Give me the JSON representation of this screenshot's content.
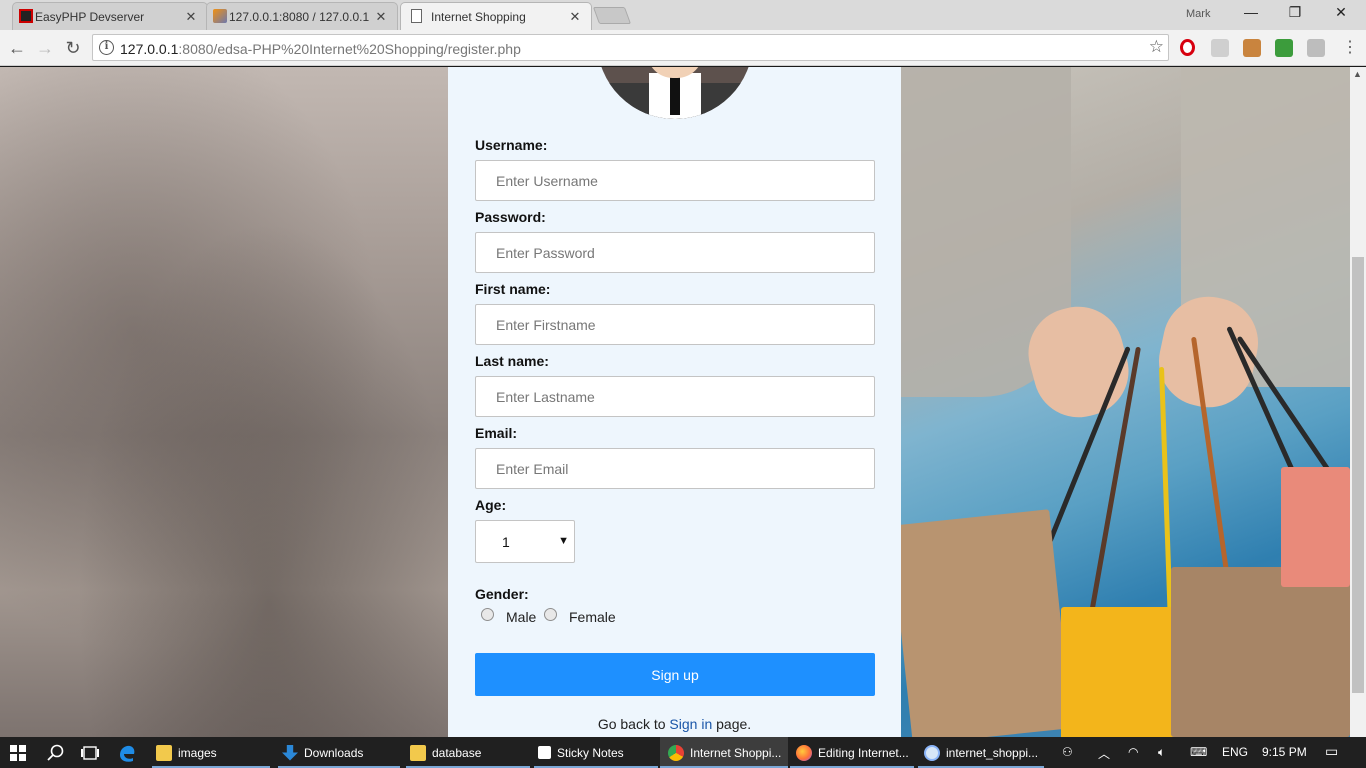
{
  "browser": {
    "tabs": [
      {
        "title": "EasyPHP Devserver",
        "close": "✕",
        "active": false
      },
      {
        "title": "127.0.0.1:8080 / 127.0.0.1",
        "close": "✕",
        "active": false
      },
      {
        "title": "Internet Shopping",
        "close": "✕",
        "active": true
      }
    ],
    "profile_name": "Mark",
    "window_controls": {
      "minimize": "—",
      "maximize": "❐",
      "close": "✕"
    },
    "nav": {
      "back": "←",
      "forward": "→",
      "reload": "↻"
    },
    "address": {
      "host": "127.0.0.1",
      "path": ":8080/edsa-PHP%20Internet%20Shopping/register.php",
      "info": "i",
      "star": "☆"
    }
  },
  "form": {
    "username": {
      "label": "Username:",
      "placeholder": "Enter Username"
    },
    "password": {
      "label": "Password:",
      "placeholder": "Enter Password"
    },
    "firstname": {
      "label": "First name:",
      "placeholder": "Enter Firstname"
    },
    "lastname": {
      "label": "Last name:",
      "placeholder": "Enter Lastname"
    },
    "email": {
      "label": "Email:",
      "placeholder": "Enter Email"
    },
    "age": {
      "label": "Age:",
      "selected": "1",
      "arrow": "▼"
    },
    "gender": {
      "label": "Gender:",
      "options": [
        "Male",
        "Female"
      ]
    },
    "signup_label": "Sign up",
    "footer": {
      "prefix": "Go back to",
      "link": "Sign in",
      "suffix": "page."
    }
  },
  "taskbar": {
    "items": [
      {
        "label": "images",
        "color": "#f2c94c"
      },
      {
        "label": "Downloads",
        "color": "#2b88d8"
      },
      {
        "label": "database",
        "color": "#f2c94c"
      },
      {
        "label": "Sticky Notes",
        "color": "#ffffff"
      },
      {
        "label": "Internet Shoppi...",
        "color": "#e94235"
      },
      {
        "label": "Editing Internet...",
        "color": "#ff7139"
      },
      {
        "label": "internet_shoppi...",
        "color": "#8ab4f8"
      }
    ],
    "language": "ENG",
    "time": "9:15 PM"
  },
  "colors": {
    "accent": "#1e90ff",
    "card_bg": "#eef6fd"
  }
}
